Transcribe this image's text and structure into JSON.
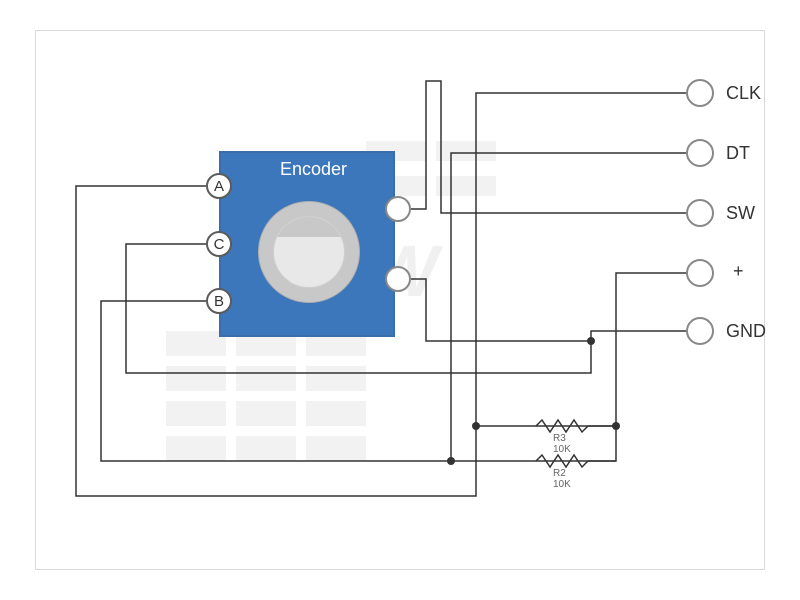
{
  "diagram": {
    "component_label": "Encoder",
    "left_pins": [
      {
        "id": "A",
        "label": "A"
      },
      {
        "id": "C",
        "label": "C"
      },
      {
        "id": "B",
        "label": "B"
      }
    ],
    "right_pins": [
      {
        "id": "SW1"
      },
      {
        "id": "SW2"
      }
    ],
    "outputs": [
      {
        "id": "CLK",
        "label": "CLK"
      },
      {
        "id": "DT",
        "label": "DT"
      },
      {
        "id": "SW",
        "label": "SW"
      },
      {
        "id": "VCC",
        "label": "+"
      },
      {
        "id": "GND",
        "label": "GND"
      }
    ],
    "resistors": [
      {
        "ref": "R3",
        "value": "10K"
      },
      {
        "ref": "R2",
        "value": "10K"
      }
    ],
    "watermark": "HW"
  }
}
